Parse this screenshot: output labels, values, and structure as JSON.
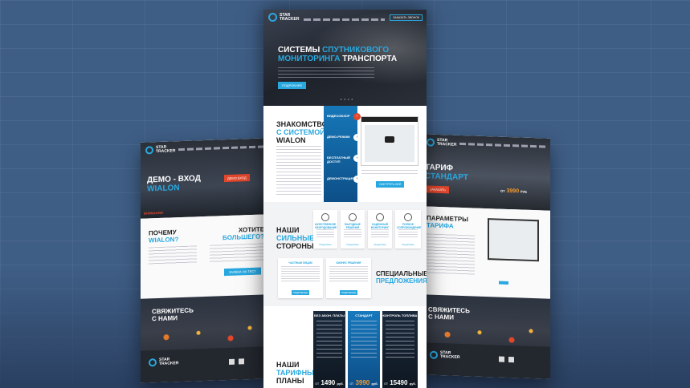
{
  "brand": {
    "name_line1": "STAR",
    "name_line2": "TRACKER",
    "accent": "#29a8e0",
    "alert": "#e2462b",
    "background": "#3f5e86"
  },
  "left_page": {
    "hero_title_line1": "ДЕМО - ВХОД",
    "hero_title_line2": "WIALON",
    "hero_button": "ДЕМО ВХОД",
    "hero_red_text": "ВНИМАНИЕ!",
    "why_title_line1": "ПОЧЕМУ",
    "why_title_line2": "WIALON?",
    "want_title_line1": "ХОТИТЕ",
    "want_title_line2": "БОЛЬШЕГО?",
    "want_button": "ЗАЯВКА НА ТЕСТ",
    "contact_title_line1": "СВЯЖИТЕСЬ",
    "contact_title_line2": "С НАМИ"
  },
  "right_page": {
    "hero_title_line1": "ТАРИФ",
    "hero_title_line2": "СТАНДАРТ",
    "hero_button": "ЗАКАЗАТЬ",
    "price_prefix": "ОТ",
    "price_value": "3990",
    "price_currency": "РУБ",
    "params_title_line1": "ПАРАМЕТРЫ",
    "params_title_line2": "ТАРИФА",
    "contact_title_line1": "СВЯЖИТЕСЬ",
    "contact_title_line2": "С НАМИ"
  },
  "center_page": {
    "header": {
      "call_button": "ЗАКАЗАТЬ ЗВОНОК"
    },
    "hero": {
      "title_line1_white": "СИСТЕМЫ",
      "title_line1_blue": "СПУТНИКОВОГО",
      "title_line2_blue": "МОНИТОРИНГА",
      "title_line2_white": "ТРАНСПОРТА",
      "button": "ПОДРОБНЕЕ",
      "dots": "• • • •"
    },
    "intro": {
      "title_line1": "ЗНАКОМСТВО",
      "title_line2": "С СИСТЕМОЙ",
      "title_line3": "WIALON",
      "tabs": [
        "ВИДЕООБЗОР",
        "ДЕМО-РЕЖИМ",
        "БЕСПЛАТНЫЙ ДОСТУП",
        "ДЕМОНСТРАЦИЯ"
      ],
      "video_button": "СМОТРЕТЬ ВСЁ"
    },
    "strengths": {
      "title_line1": "НАШИ",
      "title_line2": "СИЛЬНЫЕ",
      "title_line3": "СТОРОНЫ",
      "cards": [
        {
          "title": "КАЧЕСТВЕННОЕ ОБОРУДОВАНИЕ",
          "link": "Подробнее"
        },
        {
          "title": "ВЫГОДНЫЕ РЕШЕНИЯ",
          "link": "Подробнее"
        },
        {
          "title": "НАДЕЖНЫЙ МОНИТОРИНГ",
          "link": "Подробнее"
        },
        {
          "title": "ПОЛНОЕ СОПРОВОЖДЕНИЕ",
          "link": "Подробнее"
        }
      ],
      "offers": [
        {
          "title": "ЧАСТНЫМ ЛИЦАМ",
          "button": "ПОДРОБНЕЕ"
        },
        {
          "title": "БИЗНЕС РЕШЕНИЯ",
          "button": "ПОДРОБНЕЕ"
        }
      ],
      "special_line1": "СПЕЦИАЛЬНЫЕ",
      "special_line2": "ПРЕДЛОЖЕНИЯ"
    },
    "tariffs": {
      "title_line1": "НАШИ",
      "title_line2": "ТАРИФНЫЕ",
      "title_line3": "ПЛАНЫ",
      "plans": [
        {
          "name": "БЕЗ АБОН. ПЛАТЫ",
          "from": "ОТ",
          "price": "1490",
          "currency": "руб."
        },
        {
          "name": "СТАНДАРТ",
          "from": "ОТ",
          "price": "3990",
          "currency": "руб."
        },
        {
          "name": "КОНТРОЛЬ ТОПЛИВА",
          "from": "ОТ",
          "price": "15490",
          "currency": "руб."
        }
      ]
    }
  }
}
